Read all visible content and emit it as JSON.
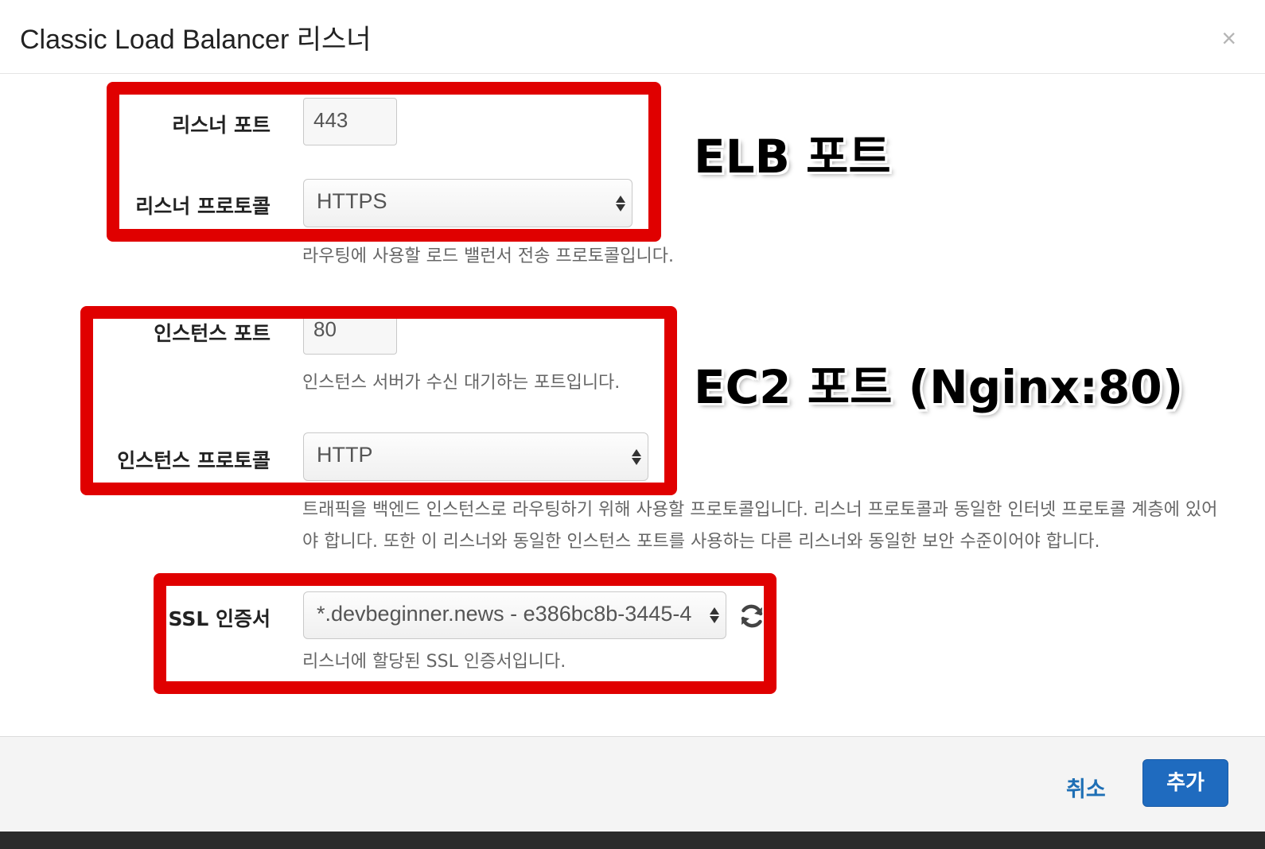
{
  "header": {
    "title": "Classic Load Balancer 리스너",
    "close_symbol": "×"
  },
  "form": {
    "listener_port": {
      "label": "리스너 포트",
      "value": "443"
    },
    "listener_protocol": {
      "label": "리스너 프로토콜",
      "value": "HTTPS",
      "help": "라우팅에 사용할 로드 밸런서 전송 프로토콜입니다."
    },
    "instance_port": {
      "label": "인스턴스 포트",
      "value": "80",
      "help": "인스턴스 서버가 수신 대기하는 포트입니다."
    },
    "instance_protocol": {
      "label": "인스턴스 프로토콜",
      "value": "HTTP",
      "help_line1": "트래픽을 백엔드 인스턴스로 라우팅하기 위해 사용할 프로토콜입니다. 리스너 프로토콜과 동일한 인터넷 프로토콜 계층에 있어",
      "help_line2": "야 합니다. 또한 이 리스너와 동일한 인스턴스 포트를 사용하는 다른 리스너와 동일한 보안 수준이어야 합니다."
    },
    "ssl_certificate": {
      "label": "SSL 인증서",
      "value": "*.devbeginner.news - e386bc8b-3445-4",
      "help": "리스너에 할당된 SSL 인증서입니다.",
      "refresh_icon": "refresh-icon"
    }
  },
  "annotations": {
    "elb_port": "ELB 포트",
    "ec2_port": "EC2 포트 (Nginx:80)",
    "highlight_color": "#e00000"
  },
  "footer": {
    "cancel_label": "취소",
    "add_label": "추가",
    "primary_color": "#1f6bbf"
  }
}
